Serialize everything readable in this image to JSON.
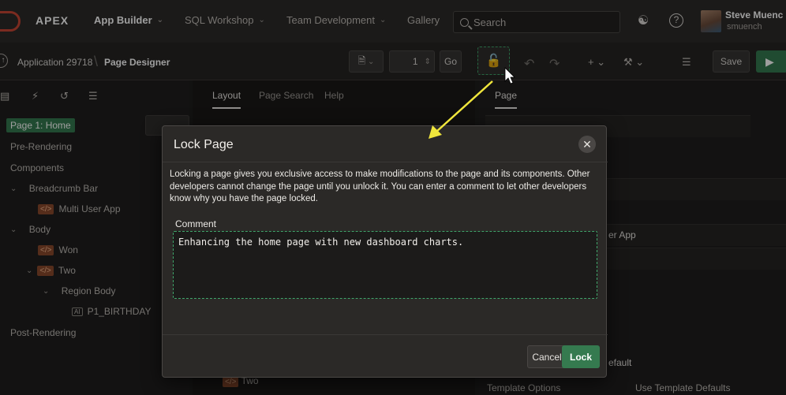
{
  "topbar": {
    "brand": "APEX",
    "nav": [
      {
        "label": "App Builder"
      },
      {
        "label": "SQL Workshop"
      },
      {
        "label": "Team Development"
      },
      {
        "label": "Gallery"
      }
    ],
    "search_placeholder": "Search",
    "user_name": "Steve Muenc",
    "user_id": "smuench"
  },
  "toolbar": {
    "crumb_app": "Application 29718",
    "crumb_page": "Page Designer",
    "page_number": "1",
    "go_label": "Go",
    "save_label": "Save"
  },
  "left": {
    "tree": [
      {
        "label": "Page 1: Home"
      },
      {
        "label": "Pre-Rendering"
      },
      {
        "label": "Components"
      },
      {
        "label": "Breadcrumb Bar"
      },
      {
        "label": "Multi User App"
      },
      {
        "label": "Body"
      },
      {
        "label": "Won"
      },
      {
        "label": "Two"
      },
      {
        "label": "Region Body"
      },
      {
        "label": "P1_BIRTHDAY"
      },
      {
        "label": "Post-Rendering"
      }
    ]
  },
  "middle": {
    "tabs": [
      {
        "label": "Layout"
      },
      {
        "label": "Page Search"
      },
      {
        "label": "Help"
      }
    ],
    "bottom_item": "Two"
  },
  "right": {
    "tab": "Page",
    "peek_value": "er App",
    "peek_default": "efault",
    "template_options": "Template Options",
    "use_defaults": "Use Template Defaults"
  },
  "modal": {
    "title": "Lock Page",
    "description": "Locking a page gives you exclusive access to make modifications to the page and its components. Other developers cannot change the page until you unlock it. You can enter a comment to let other developers know why you have the page locked.",
    "comment_label": "Comment",
    "comment_value": "Enhancing the home page with new dashboard charts.",
    "cancel_label": "Cancel",
    "lock_label": "Lock"
  },
  "colors": {
    "accent_green": "#357a4f",
    "annotation_arrow": "#f0e63c"
  }
}
